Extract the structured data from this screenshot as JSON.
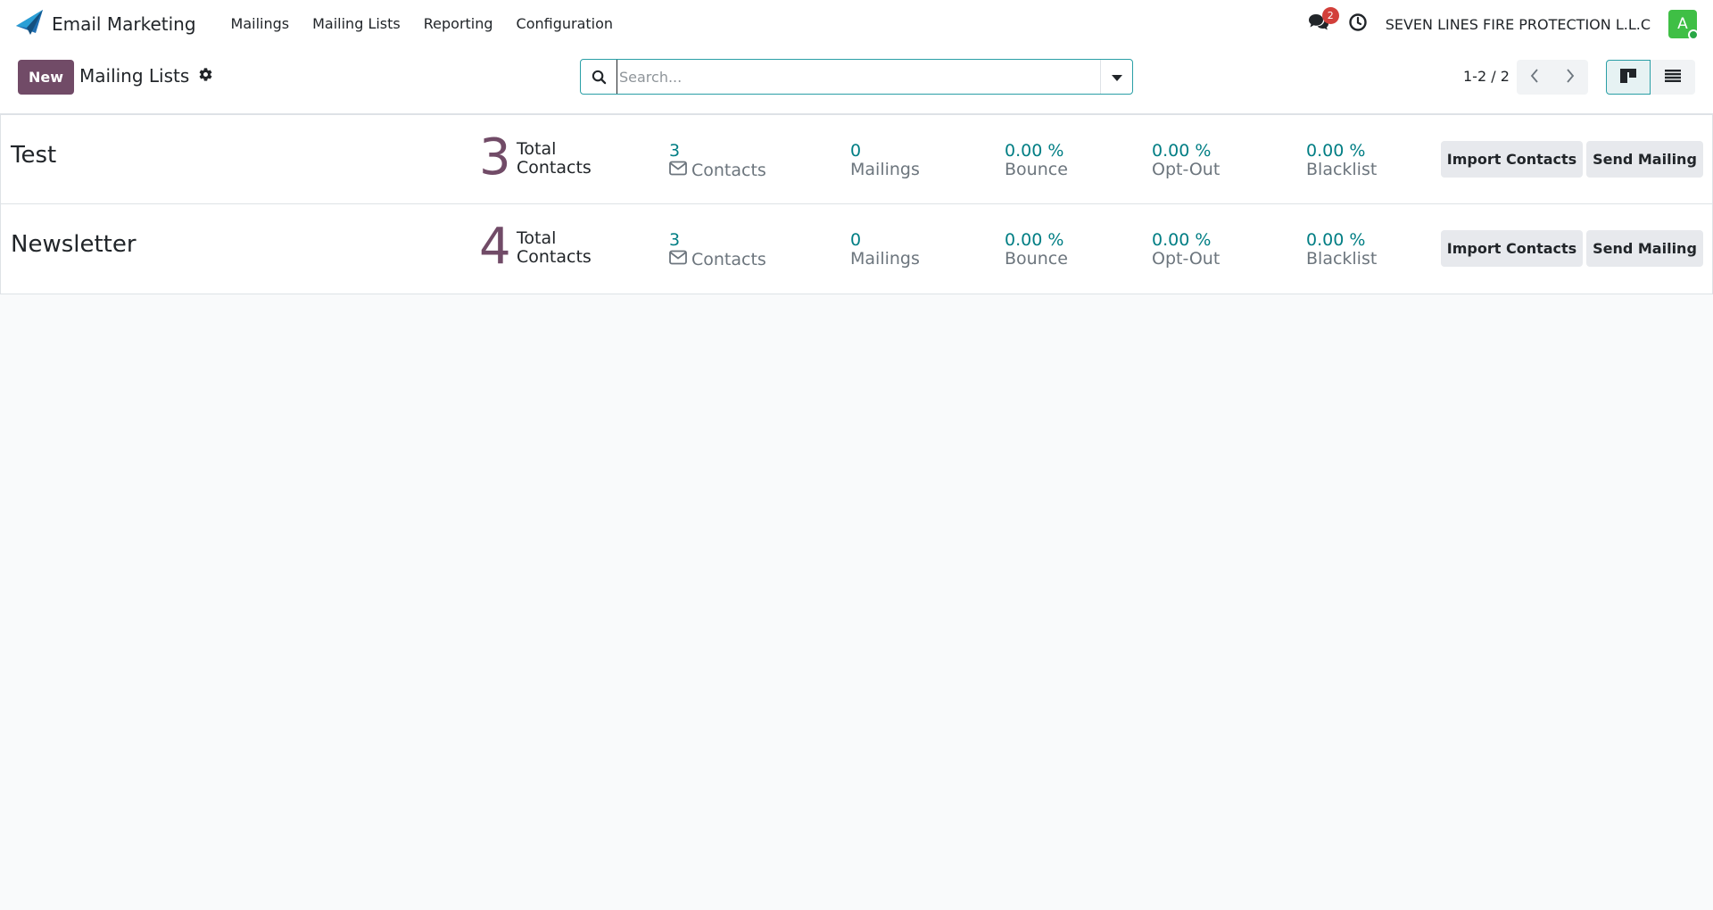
{
  "navbar": {
    "app_title": "Email Marketing",
    "menu": [
      "Mailings",
      "Mailing Lists",
      "Reporting",
      "Configuration"
    ],
    "chat_badge": "2",
    "company": "SEVEN LINES FIRE PROTECTION L.L.C",
    "avatar_letter": "A"
  },
  "control": {
    "new_label": "New",
    "breadcrumb": "Mailing Lists",
    "search_placeholder": "Search...",
    "pager": "1-2 / 2"
  },
  "rows": [
    {
      "name": "Test",
      "total": "3",
      "total_label_1": "Total",
      "total_label_2": "Contacts",
      "contacts_val": "3",
      "contacts_label": "Contacts",
      "mailings_val": "0",
      "mailings_label": "Mailings",
      "bounce_val": "0.00 %",
      "bounce_label": "Bounce",
      "optout_val": "0.00 %",
      "optout_label": "Opt-Out",
      "blacklist_val": "0.00 %",
      "blacklist_label": "Blacklist",
      "import_label": "Import Contacts",
      "send_label": "Send Mailing"
    },
    {
      "name": "Newsletter",
      "total": "4",
      "total_label_1": "Total",
      "total_label_2": "Contacts",
      "contacts_val": "3",
      "contacts_label": "Contacts",
      "mailings_val": "0",
      "mailings_label": "Mailings",
      "bounce_val": "0.00 %",
      "bounce_label": "Bounce",
      "optout_val": "0.00 %",
      "optout_label": "Opt-Out",
      "blacklist_val": "0.00 %",
      "blacklist_label": "Blacklist",
      "import_label": "Import Contacts",
      "send_label": "Send Mailing"
    }
  ],
  "colors": {
    "brand": "#714b67",
    "accent": "#017e84",
    "badge": "#d23f3a",
    "avatar": "#3fbf45"
  },
  "icons": {
    "app_logo": "paper-plane-icon",
    "breadcrumb_gear": "gear-icon",
    "chat": "chat-icon",
    "clock": "clock-icon",
    "search": "search-icon",
    "search_toggle": "caret-down-icon",
    "pager_prev": "chevron-left-icon",
    "pager_next": "chevron-right-icon",
    "view_kanban": "kanban-view-icon",
    "view_list": "list-view-icon",
    "envelope": "envelope-icon"
  }
}
